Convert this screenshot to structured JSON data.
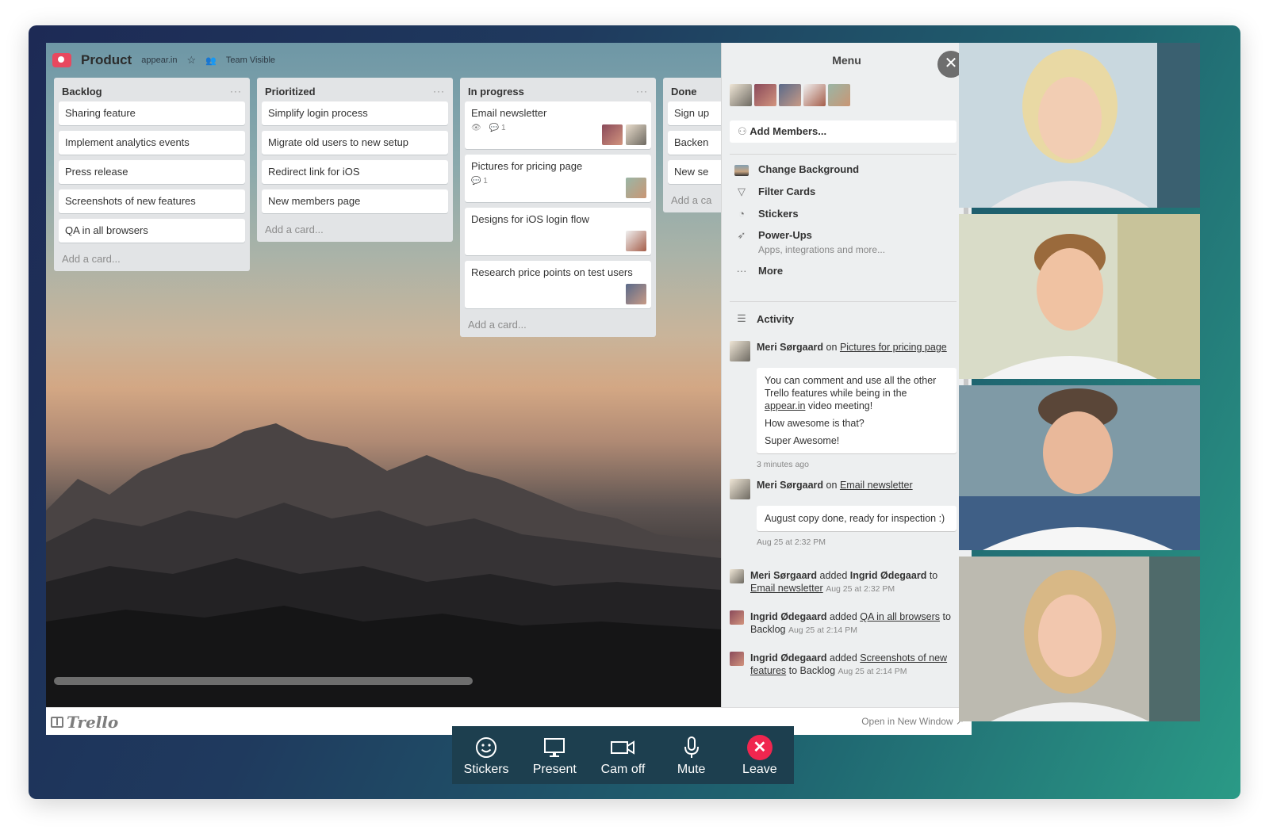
{
  "board": {
    "title": "Product",
    "workspace": "appear.in",
    "visibility": "Team Visible",
    "lists": [
      {
        "title": "Backlog",
        "cards": [
          "Sharing feature",
          "Implement analytics events",
          "Press release",
          "Screenshots of new features",
          "QA in all browsers"
        ],
        "add_card": "Add a card..."
      },
      {
        "title": "Prioritized",
        "cards": [
          "Simplify login process",
          "Migrate old users to new setup",
          "Redirect link for iOS",
          "New members page"
        ],
        "add_card": "Add a card..."
      },
      {
        "title": "In progress",
        "cards": [
          {
            "title": "Email newsletter",
            "comments": "1"
          },
          {
            "title": "Pictures for pricing page",
            "comments": "1"
          },
          {
            "title": "Designs for iOS login flow"
          },
          {
            "title": "Research price points on test users"
          }
        ],
        "add_card": "Add a card..."
      },
      {
        "title": "Done",
        "cards": [
          "Sign up",
          "Backen",
          "New se"
        ],
        "add_card": "Add a ca"
      }
    ]
  },
  "footer": {
    "brand": "Trello",
    "open_link": "Open in New Window"
  },
  "menu": {
    "title": "Menu",
    "add_members": "Add Members...",
    "items": [
      {
        "label": "Change Background",
        "icon": "background-swatch-icon"
      },
      {
        "label": "Filter Cards",
        "icon": "filter-icon"
      },
      {
        "label": "Stickers",
        "icon": "sticker-icon"
      },
      {
        "label": "Power-Ups",
        "sub": "Apps, integrations and more...",
        "icon": "rocket-icon"
      },
      {
        "label": "More",
        "icon": "ellipsis-icon"
      }
    ],
    "activity_title": "Activity",
    "activity": [
      {
        "user": "Meri Sørgaard",
        "verb": "on",
        "target": "Pictures for pricing page",
        "comment_lines": [
          "You can comment and use all the other Trello features while being in the",
          "appear.in",
          "video meeting!",
          "How awesome is that?",
          "Super Awesome!"
        ],
        "time": "3 minutes ago"
      },
      {
        "user": "Meri Sørgaard",
        "verb": "on",
        "target": "Email newsletter",
        "comment": "August copy done, ready for inspection :)",
        "time": "Aug 25 at 2:32 PM"
      },
      {
        "user": "Meri Sørgaard",
        "verb": "added",
        "object": "Ingrid Ødegaard",
        "prep": "to",
        "target": "Email newsletter",
        "time": "Aug 25 at 2:32 PM"
      },
      {
        "user": "Ingrid Ødegaard",
        "verb": "added",
        "target": "QA in all browsers",
        "dest": "to Backlog",
        "time": "Aug 25 at 2:14 PM"
      },
      {
        "user": "Ingrid Ødegaard",
        "verb": "added",
        "target": "Screenshots of new features",
        "dest": "to Backlog",
        "time": "Aug 25 at 2:14 PM"
      }
    ]
  },
  "toolbar": {
    "buttons": [
      {
        "label": "Stickers",
        "icon": "smiley-icon"
      },
      {
        "label": "Present",
        "icon": "monitor-icon"
      },
      {
        "label": "Cam off",
        "icon": "camera-icon"
      },
      {
        "label": "Mute",
        "icon": "microphone-icon"
      },
      {
        "label": "Leave",
        "icon": "close-icon"
      }
    ]
  },
  "colors": {
    "accent_leave": "#f0264f",
    "toolbar_bg": "#1d3f4f",
    "brand_pink": "#e8485f"
  }
}
